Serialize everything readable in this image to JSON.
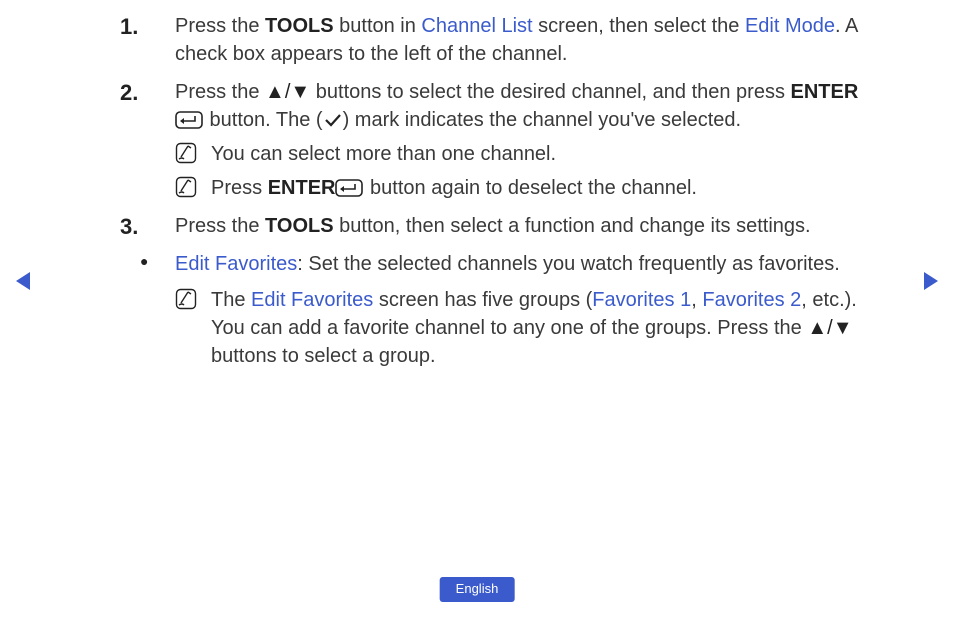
{
  "step1": {
    "t1": "Press the ",
    "tools": "TOOLS",
    "t2": " button in ",
    "chlist": "Channel List",
    "t3": " screen, then select the ",
    "editmode": "Edit Mode",
    "t4": ". A check box appears to the left of the channel."
  },
  "step2": {
    "t1": "Press the ",
    "arrows": "▲/▼",
    "t2": " buttons to select the desired channel, and then press ",
    "enter": "ENTER",
    "t3": " button. The (",
    "checkmark": "✓",
    "t4": ") mark indicates the channel you've selected.",
    "note1": "You can select more than one channel.",
    "note2a": "Press ",
    "note2_enter": "ENTER",
    "note2b": " button again to deselect the channel."
  },
  "step3": {
    "t1": "Press the ",
    "tools": "TOOLS",
    "t2": " button, then select a function and change its settings.",
    "ef": "Edit Favorites",
    "efrest": ": Set the selected channels you watch frequently as favorites.",
    "note1a": "The ",
    "note1_ef": "Edit Favorites",
    "note1b": " screen has five groups (",
    "fav1": "Favorites 1",
    "comma": ", ",
    "fav2": "Favorites 2",
    "note1c": ", etc.). You can add a favorite channel to any one of the groups. Press the ",
    "arrows": "▲/▼",
    "note1d": " buttons to select a group."
  },
  "lang": "English"
}
